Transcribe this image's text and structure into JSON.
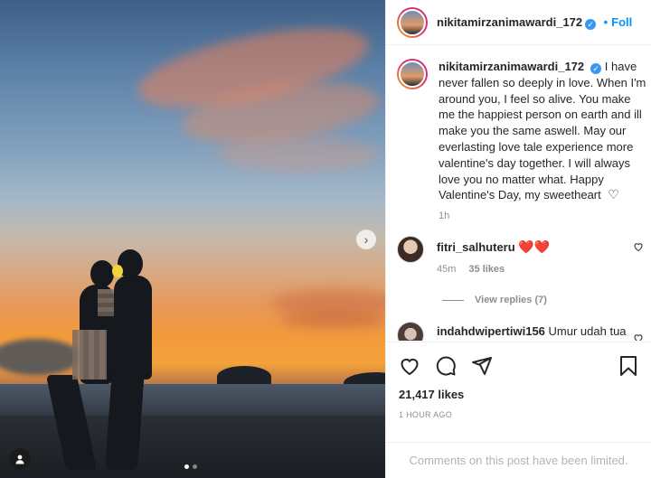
{
  "post": {
    "username": "nikitamirzanimawardi_172",
    "verified_badge": "✓",
    "follow_label": "Foll",
    "caption": "I have never fallen so deeply in love. When I'm around you, I feel so alive. You make me the happiest person on earth and ill make you the same aswell. May our everlasting love tale experience more valentine's day together. I will always love you no matter what. Happy Valentine's Day, my sweetheart",
    "caption_heart": "♡",
    "caption_time": "1h",
    "likes": "21,417 likes",
    "posted_ago": "1 HOUR AGO",
    "comments_limited": "Comments on this post have been limited."
  },
  "photo": {
    "next_icon": "›",
    "carousel_dots": 2,
    "active_dot": 0
  },
  "comments": [
    {
      "username": "fitri_salhuteru",
      "text": "❤️❤️",
      "time": "45m",
      "likes": "35 likes",
      "view_replies": "View replies (7)"
    },
    {
      "username": "indahdwipertiwi156",
      "text": "Umur udah tua"
    }
  ],
  "colors": {
    "accent": "#0095f6",
    "verified": "#3897f0",
    "muted": "#8e8e8e"
  },
  "icons": {
    "like": "heart-outline-icon",
    "comment": "comment-bubble-icon",
    "share": "paper-plane-icon",
    "save": "bookmark-icon",
    "comment_like": "heart-outline-icon"
  }
}
